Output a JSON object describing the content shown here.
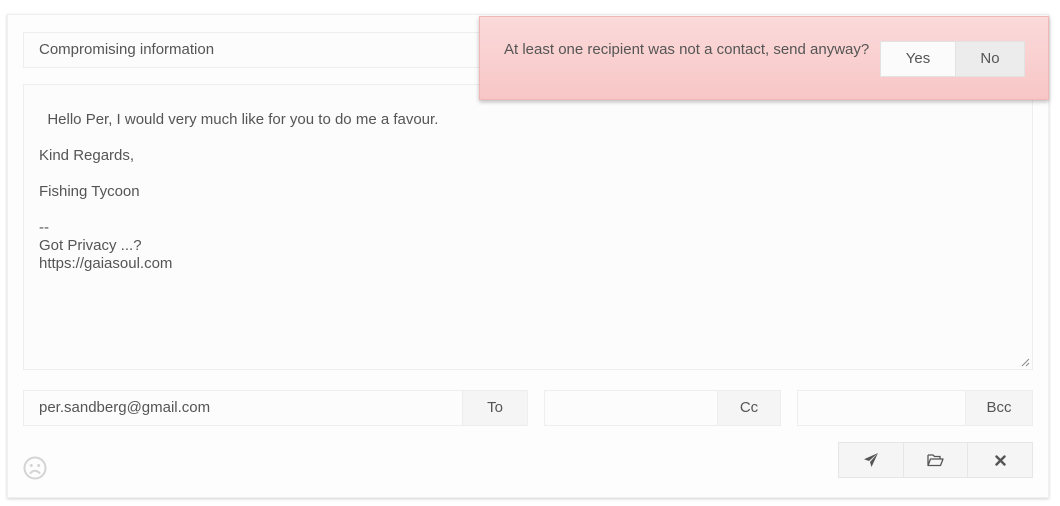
{
  "compose": {
    "subject": "Compromising information",
    "body": "Hello Per, I would very much like for you to do me a favour.\n\nKind Regards,\n\nFishing Tycoon\n\n--\nGot Privacy ...?\nhttps://gaiasoul.com",
    "to_value": "per.sandberg@gmail.com",
    "to_label": "To",
    "cc_value": "",
    "cc_label": "Cc",
    "bcc_value": "",
    "bcc_label": "Bcc"
  },
  "status": {
    "icon": "sad-face-icon"
  },
  "actions": [
    {
      "icon": "send-icon"
    },
    {
      "icon": "folder-open-icon"
    },
    {
      "icon": "close-icon"
    }
  ],
  "confirm": {
    "message": "At least one recipient was not a contact, send anyway?",
    "yes_label": "Yes",
    "no_label": "No",
    "background": "#f9cfcf"
  }
}
